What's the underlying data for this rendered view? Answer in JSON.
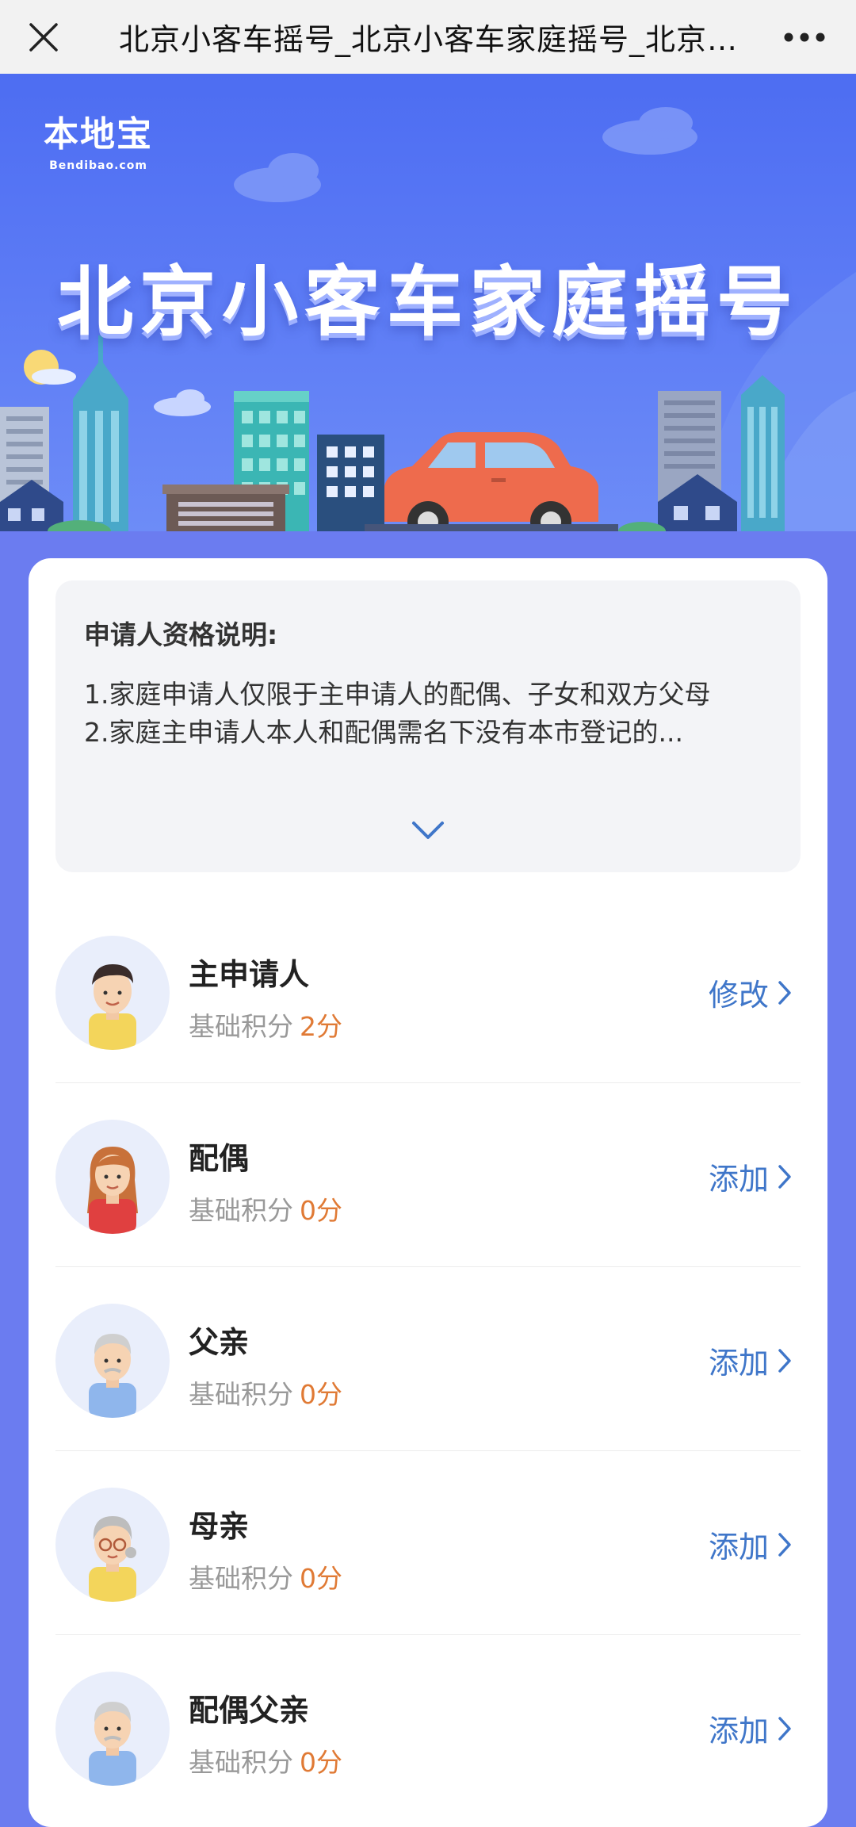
{
  "topbar": {
    "title": "北京小客车摇号_北京小客车家庭摇号_北京小客车家庭摇号积分计算",
    "close_icon": "close-icon",
    "more_icon": "more-icon"
  },
  "banner": {
    "logo_main": "本地宝",
    "logo_sub": "Bendibao.com",
    "title": "北京小客车家庭摇号"
  },
  "notice": {
    "title": "申请人资格说明:",
    "line1": "1.家庭申请人仅限于主申请人的配偶、子女和双方父母",
    "line2": "2.家庭主申请人本人和配偶需名下没有本市登记的..."
  },
  "members": [
    {
      "name": "主申请人",
      "score_label": "基础积分",
      "score": "2分",
      "action": "修改"
    },
    {
      "name": "配偶",
      "score_label": "基础积分",
      "score": "0分",
      "action": "添加"
    },
    {
      "name": "父亲",
      "score_label": "基础积分",
      "score": "0分",
      "action": "添加"
    },
    {
      "name": "母亲",
      "score_label": "基础积分",
      "score": "0分",
      "action": "添加"
    },
    {
      "name": "配偶父亲",
      "score_label": "基础积分",
      "score": "0分",
      "action": "添加"
    }
  ],
  "colors": {
    "accent_blue": "#3f76c9",
    "score_orange": "#e07a35",
    "banner_blue": "#4d6df2"
  }
}
